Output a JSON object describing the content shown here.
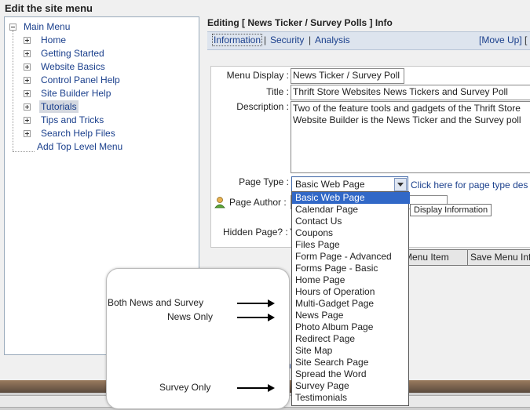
{
  "page_title": "Edit the site menu",
  "tree": {
    "root": "Main Menu",
    "items": [
      "Home",
      "Getting Started",
      "Website Basics",
      "Control Panel Help",
      "Site Builder Help",
      "Tutorials",
      "Tips and Tricks",
      "Search Help Files"
    ],
    "selected": "Tutorials",
    "add_link": "Add Top Level Menu"
  },
  "editor": {
    "heading": "Editing [ News Ticker / Survey Polls ] Info",
    "tabs": [
      "Information",
      "Security",
      "Analysis"
    ],
    "move_up": "[Move Up]",
    "separator": "|",
    "bracket_tail": "["
  },
  "form": {
    "menu_display_label": "Menu Display :",
    "menu_display_value": "News Ticker / Survey Poll",
    "title_label": "Title :",
    "title_value": "Thrift Store Websites News Tickers and Survey Poll",
    "description_label": "Description :",
    "description_value": "Two of the feature tools and gadgets of the Thrift Store Website Builder is the News Ticker and the Survey poll",
    "page_type_label": "Page Type :",
    "page_type_value": "Basic Web Page",
    "page_type_link": "Click here for page type des",
    "page_author_label": "Page Author :",
    "hidden_page_label": "Hidden Page? :",
    "hidden_page_value_fragment": "Y",
    "tooltip": "Display Information",
    "behind_text": "ne"
  },
  "page_type_options": [
    "Basic Web Page",
    "Calendar Page",
    "Contact Us",
    "Coupons",
    "Files Page",
    "Form Page - Advanced",
    "Forms Page - Basic",
    "Home Page",
    "Hours of Operation",
    "Multi-Gadget Page",
    "News Page",
    "Photo Album Page",
    "Redirect Page",
    "Site Map",
    "Site Search Page",
    "Spread the Word",
    "Survey Page",
    "Testimonials"
  ],
  "buttons": {
    "menu_item_partial": "Menu Item",
    "save_menu_partial": "Save Menu Inf"
  },
  "callout": {
    "line1": "Both News and Survey",
    "line2": "News Only",
    "line3": "Survey Only"
  },
  "colors": {
    "link": "#1a3f8c",
    "selection": "#3168c7",
    "tab_bar": "#dde4ee"
  }
}
